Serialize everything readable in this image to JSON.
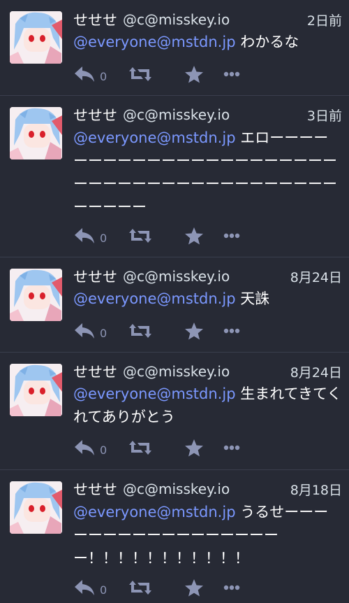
{
  "colors": {
    "background": "#272a35",
    "divider": "#3a3e4d",
    "mention": "#7b98ff",
    "action_icon": "#8d95b5",
    "meta_text": "#d9e1e8"
  },
  "statuses": [
    {
      "display_name": "せせせ",
      "acct": "@c@misskey.io",
      "date": "2日前",
      "mention": "@everyone@mstdn.jp",
      "text": " わかるな",
      "reply_count": "0"
    },
    {
      "display_name": "せせせ",
      "acct": "@c@misskey.io",
      "date": "3日前",
      "mention": "@everyone@mstdn.jp",
      "text": " エローーーーーーーーーーーーーーーーーーーーーーーーーーーーーーーーーーーーーーーーーーーーー",
      "reply_count": "0"
    },
    {
      "display_name": "せせせ",
      "acct": "@c@misskey.io",
      "date": "8月24日",
      "mention": "@everyone@mstdn.jp",
      "text": " 天誅",
      "reply_count": "0"
    },
    {
      "display_name": "せせせ",
      "acct": "@c@misskey.io",
      "date": "8月24日",
      "mention": "@everyone@mstdn.jp",
      "text": " 生まれてきてくれてありがとう",
      "reply_count": "0"
    },
    {
      "display_name": "せせせ",
      "acct": "@c@misskey.io",
      "date": "8月18日",
      "mention": "@everyone@mstdn.jp",
      "text": " うるせーーーーーーーーーーーーーーーーーー！！！！！！！！！！！",
      "reply_count": "0"
    }
  ]
}
